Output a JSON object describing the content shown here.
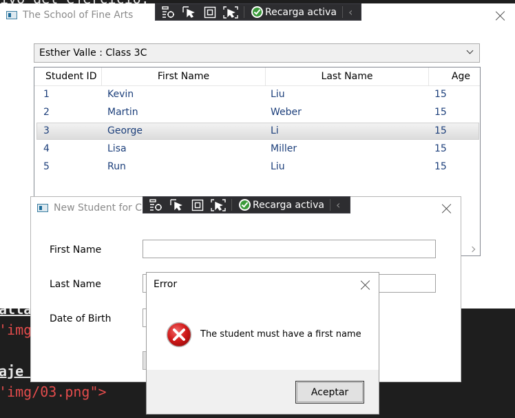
{
  "editor": {
    "lines": [
      {
        "text": "ivo del ejercicio.",
        "color": "#e8e8e8"
      },
      {
        "text": "alla",
        "color": "#e8e8e8"
      },
      {
        "text": "'img",
        "color": "#e34c4c"
      },
      {
        "text": "aje ",
        "color": "#e8e8e8"
      },
      {
        "text": "'img/03.png\">",
        "color": "#e34c4c"
      }
    ]
  },
  "main_window": {
    "title": "The School of Fine Arts",
    "toolbar": {
      "hot_reload_label": "Recarga activa"
    },
    "combo": {
      "selected": "Esther Valle : Class 3C"
    },
    "grid": {
      "columns": [
        "Student ID",
        "First Name",
        "Last Name",
        "Age"
      ],
      "rows": [
        [
          "1",
          "Kevin",
          "Liu",
          "15"
        ],
        [
          "2",
          "Martin",
          "Weber",
          "15"
        ],
        [
          "3",
          "George",
          "Li",
          "15"
        ],
        [
          "4",
          "Lisa",
          "Miller",
          "15"
        ],
        [
          "5",
          "Run",
          "Liu",
          "15"
        ]
      ],
      "selected_row_index": 2
    }
  },
  "new_student_window": {
    "title": "New Student for Cla",
    "toolbar": {
      "hot_reload_label": "Recarga activa"
    },
    "labels": {
      "first_name": "First Name",
      "last_name": "Last Name",
      "date_of_birth": "Date of Birth"
    },
    "values": {
      "first_name": "",
      "last_name": ""
    }
  },
  "error_dialog": {
    "title": "Error",
    "message": "The student must have a first name",
    "accept_label": "Aceptar",
    "icon": "error-icon"
  }
}
